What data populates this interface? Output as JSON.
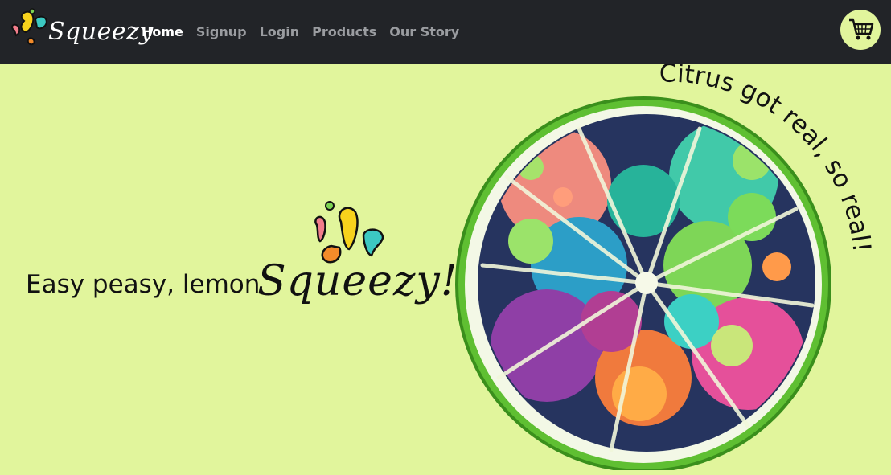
{
  "navbar": {
    "logo_text": "Squeezy",
    "links": [
      {
        "label": "Home",
        "active": true
      },
      {
        "label": "Signup",
        "active": false
      },
      {
        "label": "Login",
        "active": false
      },
      {
        "label": "Products",
        "active": false
      },
      {
        "label": "Our Story",
        "active": false
      }
    ],
    "cart_icon": "shopping-cart-icon"
  },
  "hero": {
    "tagline": "Easy peasy, lemon",
    "brand": "Squeezy!",
    "curved_text": "Citrus got real, so real!"
  },
  "colors": {
    "navbar_bg": "#222428",
    "page_bg": "#e1f59c",
    "nav_active": "#ffffff",
    "nav_inactive": "#9a9ca0",
    "rind": "#4caf2a"
  }
}
